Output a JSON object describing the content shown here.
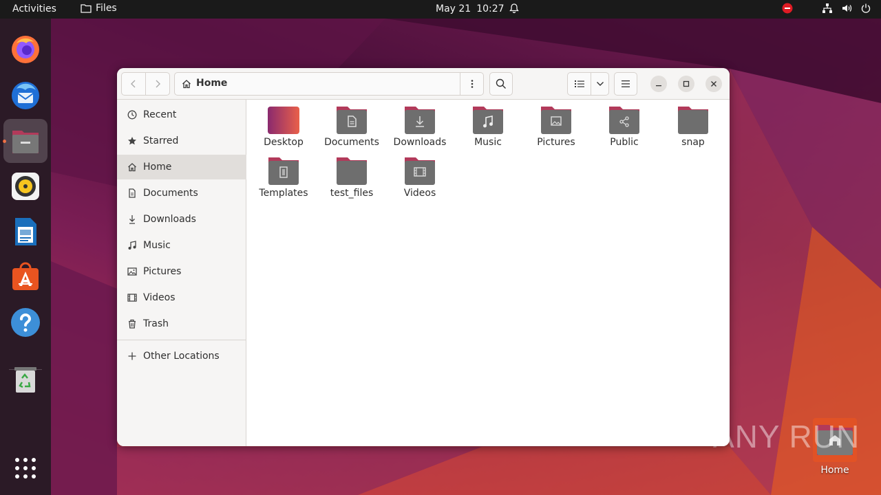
{
  "topbar": {
    "activities": "Activities",
    "app_name": "Files",
    "date": "May 21",
    "time": "10:27"
  },
  "dock": {
    "items": [
      {
        "name": "firefox-icon"
      },
      {
        "name": "thunderbird-icon"
      },
      {
        "name": "files-icon"
      },
      {
        "name": "rhythmbox-icon"
      },
      {
        "name": "libreoffice-writer-icon"
      },
      {
        "name": "app-center-icon"
      },
      {
        "name": "help-icon"
      },
      {
        "name": "trash-icon"
      },
      {
        "name": "show-apps-icon"
      }
    ]
  },
  "window": {
    "path": "Home"
  },
  "sidebar": {
    "items": [
      {
        "label": "Recent",
        "icon": "clock-icon"
      },
      {
        "label": "Starred",
        "icon": "star-icon"
      },
      {
        "label": "Home",
        "icon": "home-icon"
      },
      {
        "label": "Documents",
        "icon": "document-icon"
      },
      {
        "label": "Downloads",
        "icon": "download-icon"
      },
      {
        "label": "Music",
        "icon": "music-icon"
      },
      {
        "label": "Pictures",
        "icon": "picture-icon"
      },
      {
        "label": "Videos",
        "icon": "video-icon"
      },
      {
        "label": "Trash",
        "icon": "trash-icon"
      }
    ],
    "other_locations": "Other Locations"
  },
  "files": [
    {
      "label": "Desktop",
      "icon": "desktop-folder-icon"
    },
    {
      "label": "Documents",
      "icon": "documents-folder-icon"
    },
    {
      "label": "Downloads",
      "icon": "downloads-folder-icon"
    },
    {
      "label": "Music",
      "icon": "music-folder-icon"
    },
    {
      "label": "Pictures",
      "icon": "pictures-folder-icon"
    },
    {
      "label": "Public",
      "icon": "public-folder-icon"
    },
    {
      "label": "snap",
      "icon": "folder-icon"
    },
    {
      "label": "Templates",
      "icon": "templates-folder-icon"
    },
    {
      "label": "test_files",
      "icon": "folder-icon"
    },
    {
      "label": "Videos",
      "icon": "videos-folder-icon"
    }
  ],
  "desktop": {
    "home_label": "Home"
  },
  "watermark": "ANY RUN",
  "colors": {
    "accent": "#e95420",
    "folder_body": "#6e6e6e",
    "folder_tab": "#b23a5a",
    "topbar": "#1a1a1a"
  }
}
